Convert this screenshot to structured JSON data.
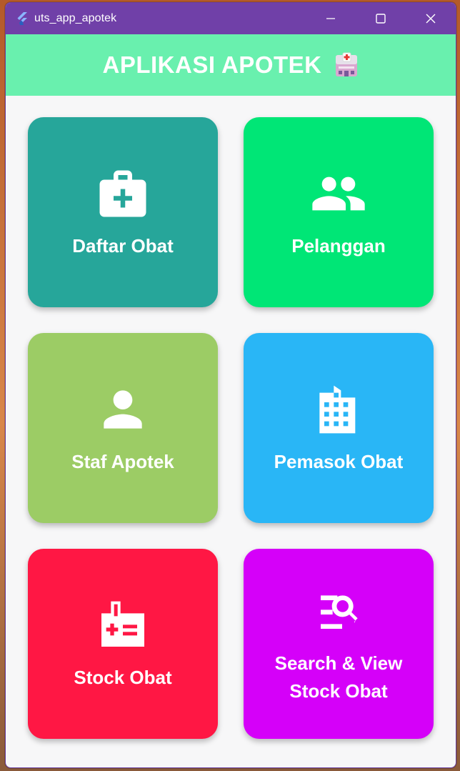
{
  "window": {
    "title": "uts_app_apotek",
    "titlebar_color": "#7040a8"
  },
  "appbar": {
    "title": "APLIKASI APOTEK",
    "emoji_icon": "hospital-icon",
    "background": "#69f0ae"
  },
  "menu": [
    {
      "label": "Daftar Obat",
      "icon": "medical-kit-icon",
      "color": "#26a69a"
    },
    {
      "label": "Pelanggan",
      "icon": "people-icon",
      "color": "#00e676"
    },
    {
      "label": "Staf Apotek",
      "icon": "person-icon",
      "color": "#9ccc65"
    },
    {
      "label": "Pemasok Obat",
      "icon": "building-icon",
      "color": "#29b6f6"
    },
    {
      "label": "Stock Obat",
      "icon": "medical-stock-icon",
      "color": "#ff1744"
    },
    {
      "label": "Search & View Stock Obat",
      "icon": "search-list-icon",
      "color": "#d500f9"
    }
  ]
}
